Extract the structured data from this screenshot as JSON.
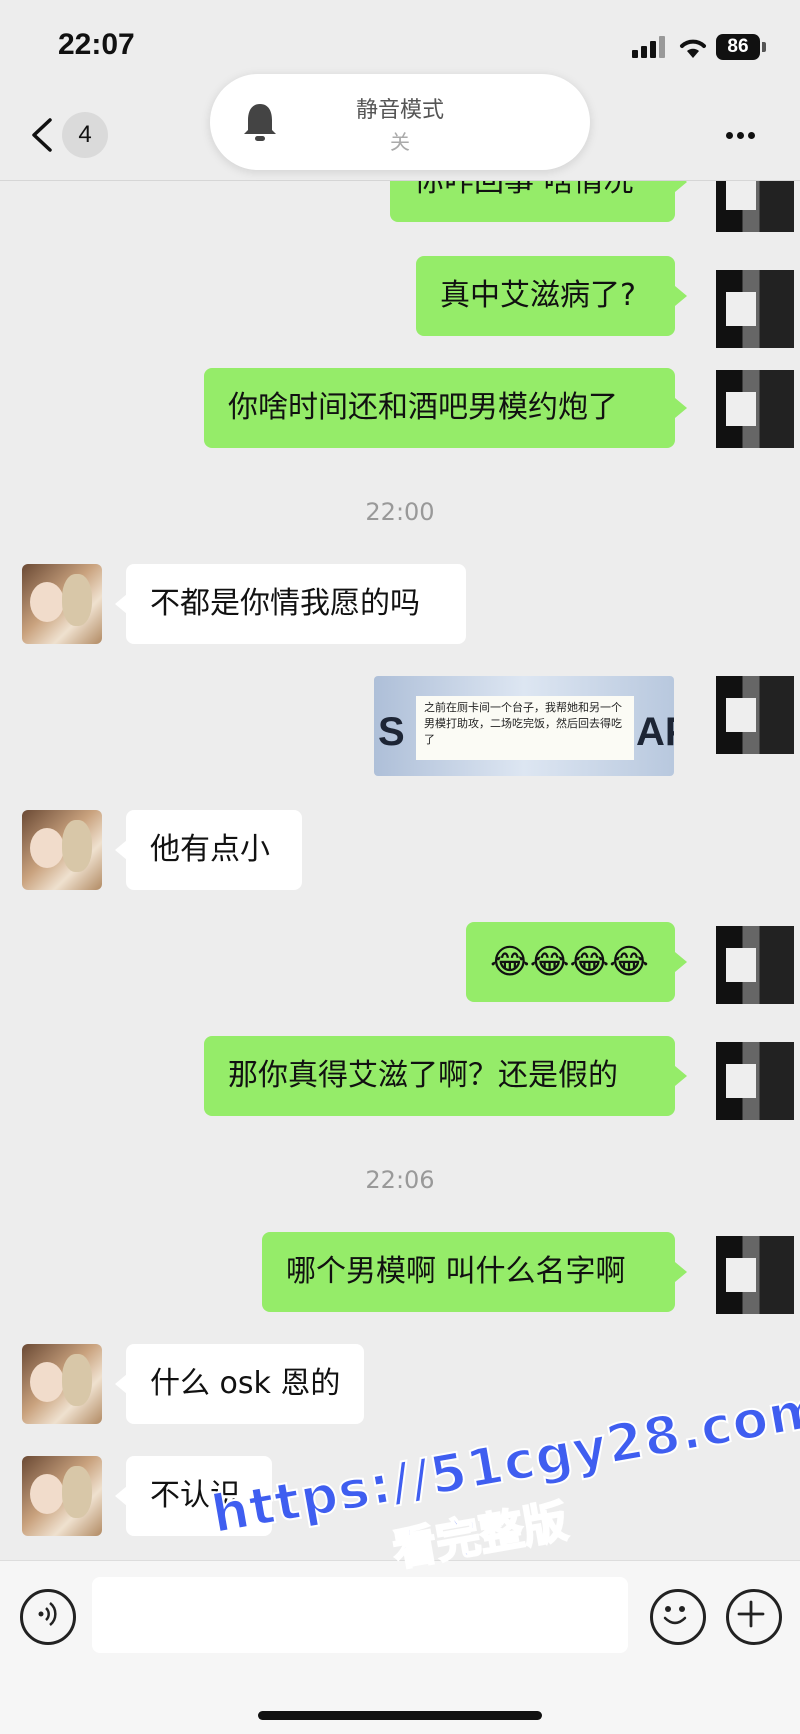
{
  "status_bar": {
    "time": "22:07",
    "battery": "86"
  },
  "nav": {
    "unread_count": "4"
  },
  "toast": {
    "title": "静音模式",
    "state": "关"
  },
  "messages": [
    {
      "from": "me",
      "text": "你咋回事 啥情况"
    },
    {
      "from": "me",
      "text": "真中艾滋病了?"
    },
    {
      "from": "me",
      "text": "你啥时间还和酒吧男模约炮了"
    },
    {
      "from": "time",
      "text": "22:00"
    },
    {
      "from": "them",
      "text": "不都是你情我愿的吗"
    },
    {
      "from": "me",
      "type": "image",
      "text": "之前在厕卡间一个台子，我帮她和另一个男模打助攻，二场吃完饭，然后回去得吃了"
    },
    {
      "from": "them",
      "text": "他有点小"
    },
    {
      "from": "me",
      "text": "😂😂😂😂"
    },
    {
      "from": "me",
      "text": "那你真得艾滋了啊？还是假的"
    },
    {
      "from": "time",
      "text": "22:06"
    },
    {
      "from": "me",
      "text": "哪个男模啊 叫什么名字啊"
    },
    {
      "from": "them",
      "text": "什么 osk 恩的"
    },
    {
      "from": "them",
      "text": "不认识"
    }
  ],
  "image_big_left": "S",
  "image_big_right": "AP",
  "watermark": {
    "url": "https://51cgy28.com",
    "sub": "看完整版"
  },
  "icons": [
    "back-icon",
    "more-icon",
    "bell-icon",
    "voice-icon",
    "emoji-icon",
    "plus-icon"
  ]
}
